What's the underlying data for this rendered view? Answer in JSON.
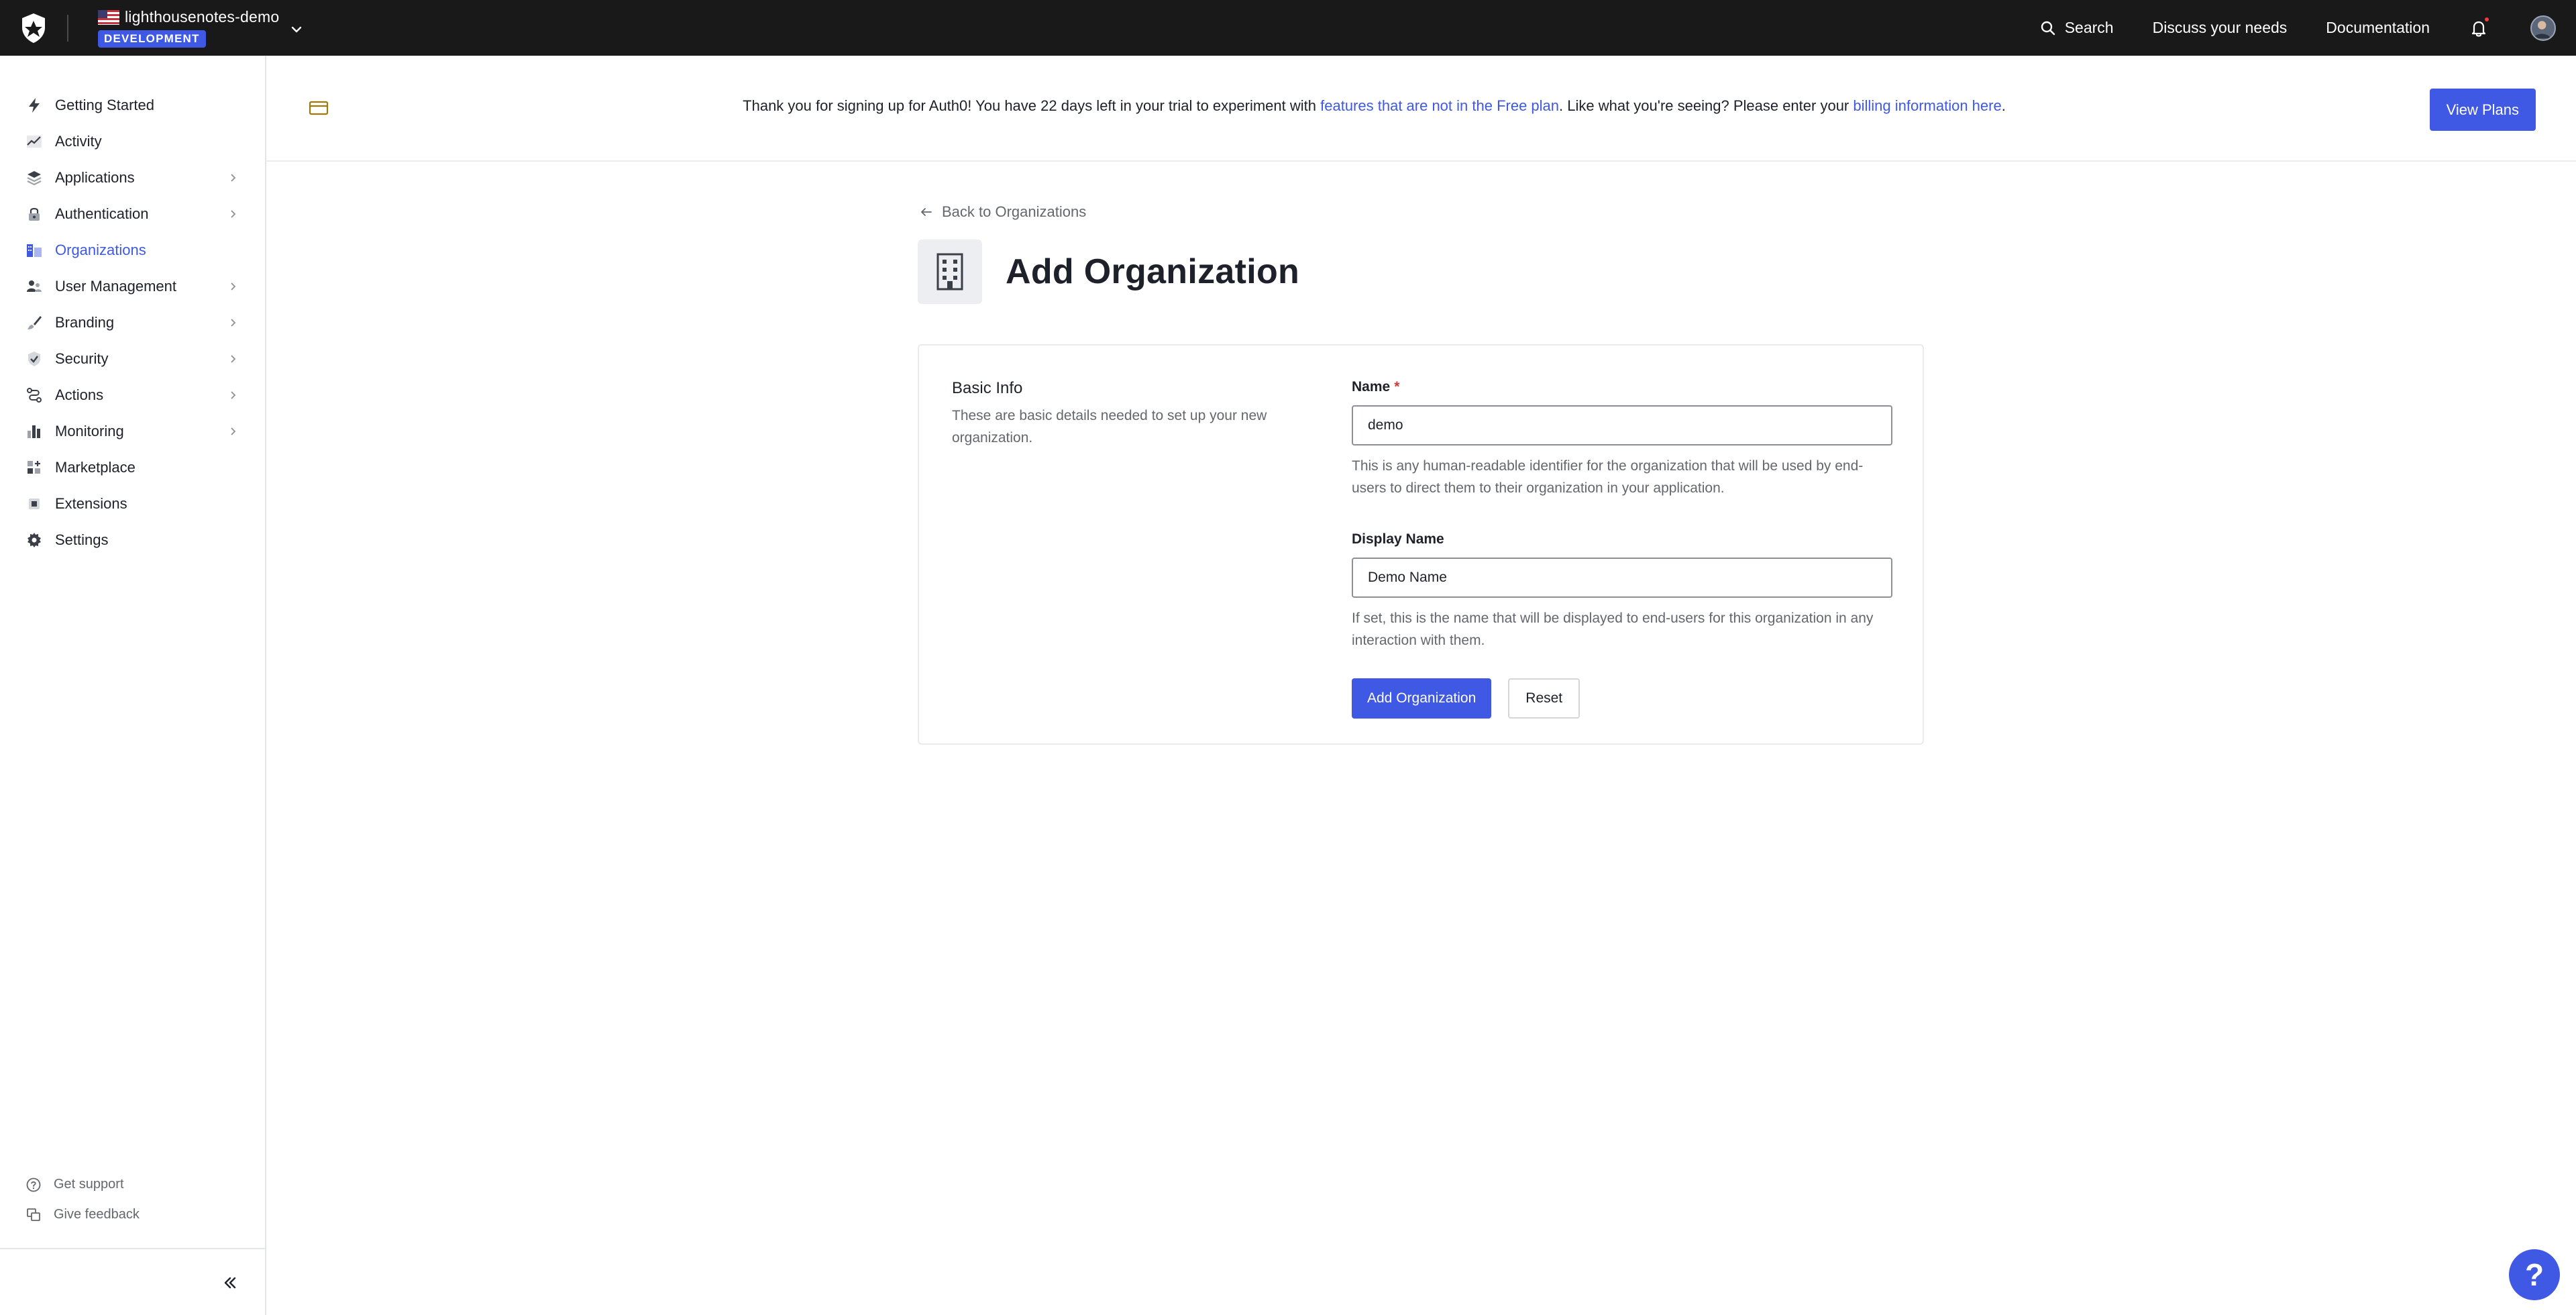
{
  "tenant": {
    "name": "lighthousenotes-demo",
    "environment": "DEVELOPMENT"
  },
  "topnav": {
    "search": "Search",
    "discuss": "Discuss your needs",
    "docs": "Documentation"
  },
  "sidebar": {
    "items": [
      {
        "label": "Getting Started",
        "icon": "bolt-icon",
        "chevron": false
      },
      {
        "label": "Activity",
        "icon": "activity-chart-icon",
        "chevron": false
      },
      {
        "label": "Applications",
        "icon": "applications-layers-icon",
        "chevron": true
      },
      {
        "label": "Authentication",
        "icon": "lock-icon",
        "chevron": true
      },
      {
        "label": "Organizations",
        "icon": "organizations-icon",
        "chevron": false,
        "active": true
      },
      {
        "label": "User Management",
        "icon": "users-icon",
        "chevron": true
      },
      {
        "label": "Branding",
        "icon": "brush-icon",
        "chevron": true
      },
      {
        "label": "Security",
        "icon": "shield-check-icon",
        "chevron": true
      },
      {
        "label": "Actions",
        "icon": "actions-flow-icon",
        "chevron": true
      },
      {
        "label": "Monitoring",
        "icon": "bar-chart-icon",
        "chevron": true
      },
      {
        "label": "Marketplace",
        "icon": "marketplace-grid-icon",
        "chevron": false
      },
      {
        "label": "Extensions",
        "icon": "extensions-chip-icon",
        "chevron": false
      },
      {
        "label": "Settings",
        "icon": "gear-icon",
        "chevron": false
      }
    ],
    "support": "Get support",
    "feedback": "Give feedback"
  },
  "banner": {
    "text_before": "Thank you for signing up for Auth0! You have 22 days left in your trial to experiment with ",
    "link1": "features that are not in the Free plan",
    "text_middle": ". Like what you're seeing? Please enter your ",
    "link2": "billing information here",
    "text_after": ".",
    "button": "View Plans"
  },
  "page": {
    "back_link": "Back to Organizations",
    "title": "Add Organization"
  },
  "form": {
    "section_title": "Basic Info",
    "section_desc": "These are basic details needed to set up your new organization.",
    "name_label": "Name",
    "name_required": "*",
    "name_value": "demo",
    "name_help": "This is any human-readable identifier for the organization that will be used by end-users to direct them to their organization in your application.",
    "display_label": "Display Name",
    "display_value": "Demo Name",
    "display_help": "If set, this is the name that will be displayed to end-users for this organization in any interaction with them.",
    "submit": "Add Organization",
    "reset": "Reset"
  },
  "colors": {
    "accent": "#3f59e4",
    "topbar": "#191919",
    "required": "#d03c38"
  }
}
